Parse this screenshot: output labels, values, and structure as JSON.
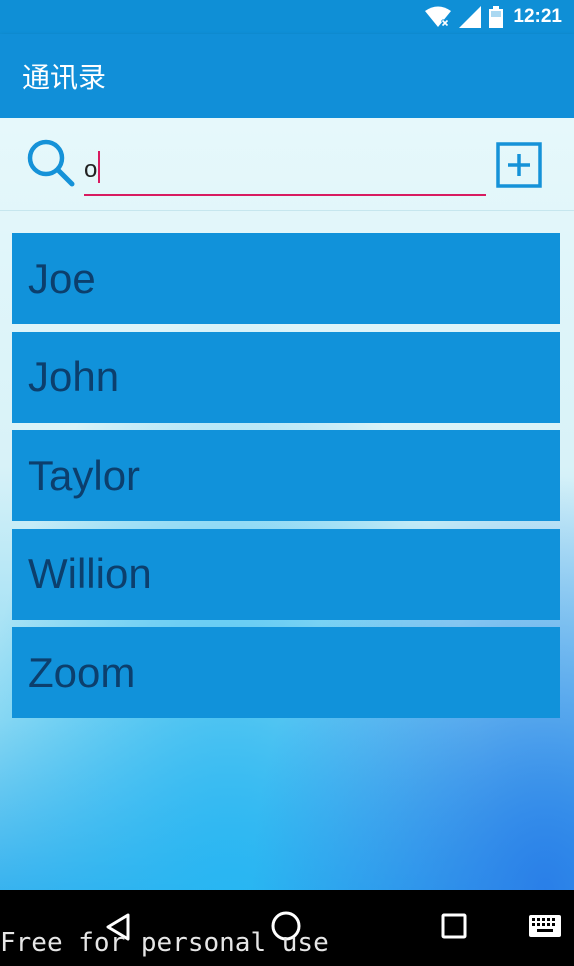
{
  "status_bar": {
    "time": "12:21",
    "icons": [
      "wifi-icon",
      "cellular-signal-icon",
      "battery-icon"
    ]
  },
  "app_bar": {
    "title": "通讯录"
  },
  "search": {
    "value": "o",
    "icon": "search-icon",
    "add_icon": "add-box-icon"
  },
  "contacts": [
    {
      "name": "Joe"
    },
    {
      "name": "John"
    },
    {
      "name": "Taylor"
    },
    {
      "name": "Willion"
    },
    {
      "name": "Zoom"
    }
  ],
  "nav_bar": {
    "buttons": [
      "back-icon",
      "home-icon",
      "recents-icon",
      "keyboard-icon"
    ]
  },
  "watermark": "Free for personal use",
  "colors": {
    "app_bar": "#118fd8",
    "list_item": "#1192da",
    "list_text": "#0c3f6d",
    "accent": "#d81b60"
  }
}
